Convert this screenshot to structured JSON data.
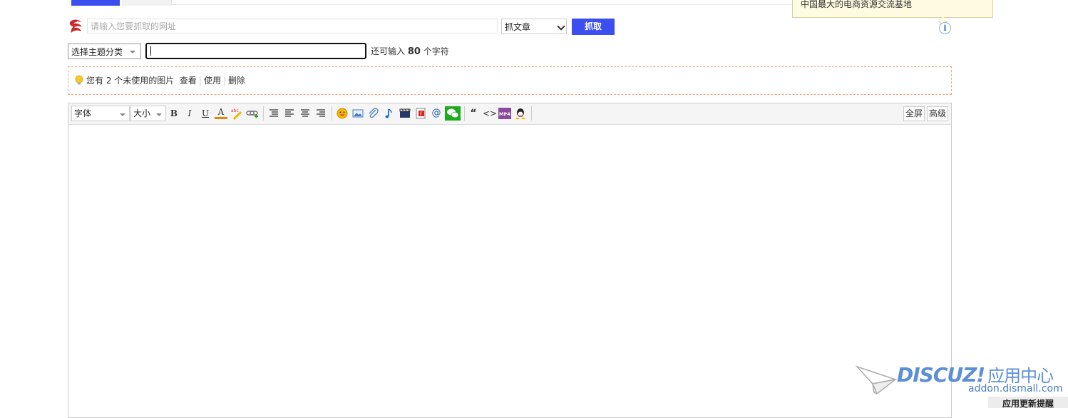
{
  "tooltip": {
    "text": "中国最大的电商资源交流基地"
  },
  "grab": {
    "url_placeholder": "请输入您要抓取的网址",
    "type_selected": "抓文章",
    "grab_button": "抓取"
  },
  "category": {
    "selected": "选择主题分类",
    "remain_prefix": "还可输入",
    "remain_count": "80",
    "remain_suffix": "个字符"
  },
  "notice": {
    "text": "您有 2 个未使用的图片",
    "view": "查看",
    "use": "使用",
    "delete": "删除"
  },
  "editor": {
    "font_select": "字体",
    "size_select": "大小",
    "fullscreen": "全屏",
    "advanced": "高级",
    "buttons": {
      "bold": "B",
      "italic": "I",
      "underline": "U",
      "fontcolor": "A",
      "quote": "“",
      "code": "<>",
      "at": "@"
    }
  },
  "watermark": {
    "brand": "DISCUZ!",
    "brand_cn": "应用中心",
    "domain": "addon.dismall.com",
    "update_text": "应用更新提醒"
  },
  "colors": {
    "accent": "#3d4ef0",
    "notice_border": "#f3a483",
    "watermark": "#5c8fd6"
  }
}
